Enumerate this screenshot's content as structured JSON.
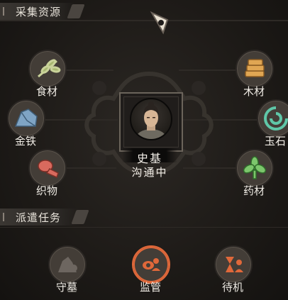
{
  "gather": {
    "title": "采集资源",
    "resources": [
      {
        "label": "食材",
        "icon": "herb-icon"
      },
      {
        "label": "木材",
        "icon": "lumber-icon"
      },
      {
        "label": "金铁",
        "icon": "ore-icon"
      },
      {
        "label": "玉石",
        "icon": "jade-icon"
      },
      {
        "label": "织物",
        "icon": "fabric-icon"
      },
      {
        "label": "药材",
        "icon": "medicine-icon"
      }
    ]
  },
  "character": {
    "name": "史基",
    "status": "沟通中"
  },
  "dispatch": {
    "title": "派遣任务",
    "tasks": [
      {
        "label": "守墓",
        "icon": "tomb-guard-icon",
        "active": false
      },
      {
        "label": "监管",
        "icon": "supervise-icon",
        "active": true
      },
      {
        "label": "待机",
        "icon": "standby-icon",
        "active": false
      }
    ]
  },
  "colors": {
    "accent": "#e0683a",
    "ring": "#5a534b",
    "text": "#f1ede6"
  }
}
